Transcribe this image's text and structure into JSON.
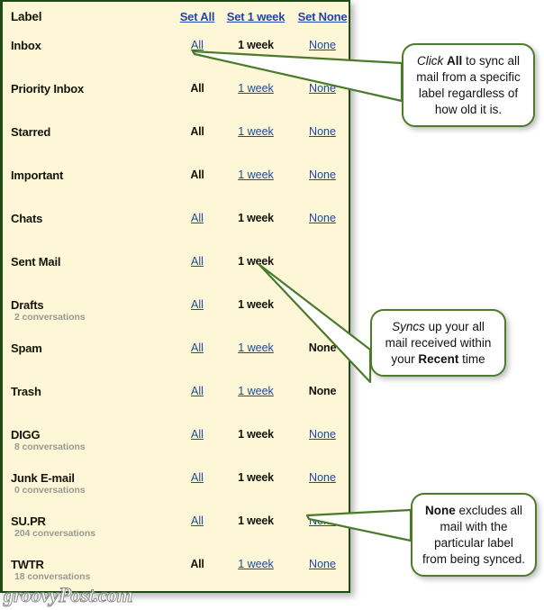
{
  "panel": {
    "header": {
      "label_column": "Label",
      "set_all": "Set All",
      "set_week": "Set 1 week",
      "set_none": "Set None"
    },
    "options": {
      "all": "All",
      "week": "1 week",
      "none": "None"
    },
    "rows": [
      {
        "label": "Inbox",
        "sub": "",
        "all_state": "link",
        "week_state": "selected",
        "none_state": "link"
      },
      {
        "label": "Priority Inbox",
        "sub": "",
        "all_state": "selected",
        "week_state": "link",
        "none_state": "link"
      },
      {
        "label": "Starred",
        "sub": "",
        "all_state": "selected",
        "week_state": "link",
        "none_state": "link"
      },
      {
        "label": "Important",
        "sub": "",
        "all_state": "selected",
        "week_state": "link",
        "none_state": "link"
      },
      {
        "label": "Chats",
        "sub": "",
        "all_state": "link",
        "week_state": "selected",
        "none_state": "link"
      },
      {
        "label": "Sent Mail",
        "sub": "",
        "all_state": "link",
        "week_state": "selected",
        "none_state": "hidden"
      },
      {
        "label": "Drafts",
        "sub": "2 conversations",
        "all_state": "link",
        "week_state": "selected",
        "none_state": "hidden"
      },
      {
        "label": "Spam",
        "sub": "",
        "all_state": "link",
        "week_state": "link",
        "none_state": "selected"
      },
      {
        "label": "Trash",
        "sub": "",
        "all_state": "link",
        "week_state": "link",
        "none_state": "selected"
      },
      {
        "label": "DIGG",
        "sub": "8 conversations",
        "all_state": "link",
        "week_state": "selected",
        "none_state": "link"
      },
      {
        "label": "Junk E-mail",
        "sub": "0 conversations",
        "all_state": "link",
        "week_state": "selected",
        "none_state": "link"
      },
      {
        "label": "SU.PR",
        "sub": "204 conversations",
        "all_state": "link",
        "week_state": "selected",
        "none_state": "link"
      },
      {
        "label": "TWTR",
        "sub": "18 conversations",
        "all_state": "selected",
        "week_state": "link",
        "none_state": "link"
      }
    ]
  },
  "callouts": {
    "all": {
      "text": "Click All to sync all mail from a specific label regardless of how old it is.",
      "part_italic": "Click",
      "part_bold": "All",
      "part_rest": " to sync all mail from a specific label regardless of how old it is."
    },
    "week": {
      "text": "Syncs up your all mail received within your Recent time",
      "part_italic": "Syncs",
      "part_mid": " up your all mail received within your ",
      "part_bold": "Recent",
      "part_rest": " time"
    },
    "none": {
      "text": "None excludes all mail with the particular label from being synced.",
      "part_bold": "None",
      "part_rest": " excludes all mail with the particular label from being synced."
    }
  },
  "watermark": "groovyPost.com",
  "colors": {
    "panel_background": "#fdf7d7",
    "panel_border": "#1e4a16",
    "link": "#2145a8",
    "selected_text": "#16120a",
    "sub_text": "#9a9a93",
    "callout_border": "#4e7a2c",
    "pointer_stroke": "#4a7a2a"
  }
}
